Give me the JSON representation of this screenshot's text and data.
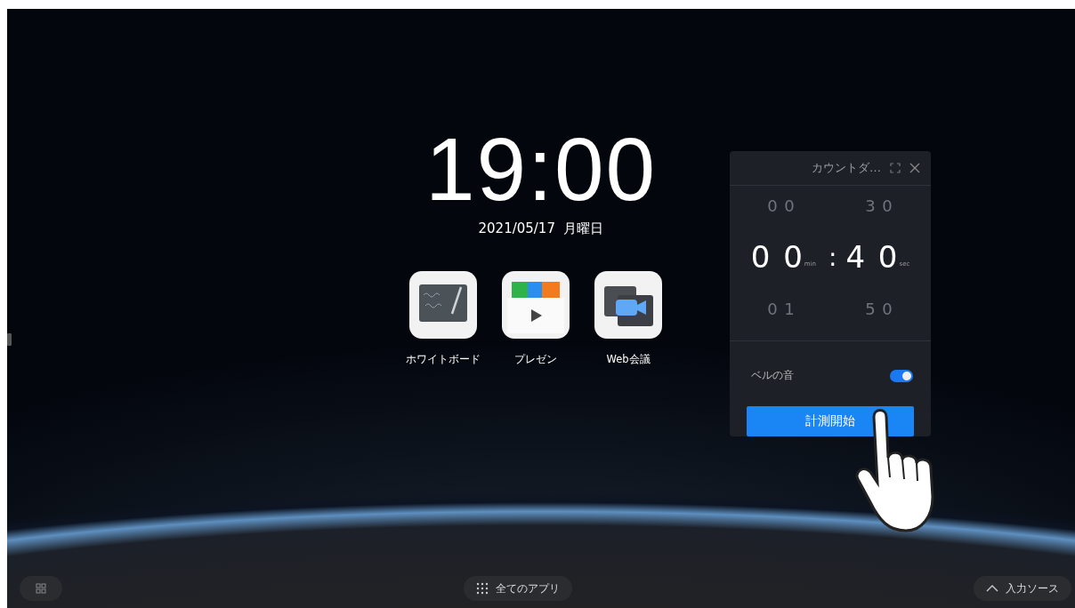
{
  "home": {
    "time": "19:00",
    "date": "2021/05/17  月曜日",
    "apps": [
      {
        "label": "ホワイトボード",
        "kind": "whiteboard"
      },
      {
        "label": "プレゼン",
        "kind": "presentation"
      },
      {
        "label": "Web会議",
        "kind": "meeting"
      }
    ]
  },
  "timer": {
    "title": "カウントダ…",
    "above": [
      "0 0",
      "3 0"
    ],
    "current": {
      "minutes": "0 0",
      "min_unit": "min",
      "separator": ":",
      "seconds": "4 0",
      "sec_unit": "sec"
    },
    "below": [
      "0 1",
      "5 0"
    ],
    "bell": {
      "label": "ベルの音",
      "on": true
    },
    "start_button": "計測開始"
  },
  "bottom_bar": {
    "all_apps": "全てのアプリ",
    "input_source": "入力ソース"
  }
}
